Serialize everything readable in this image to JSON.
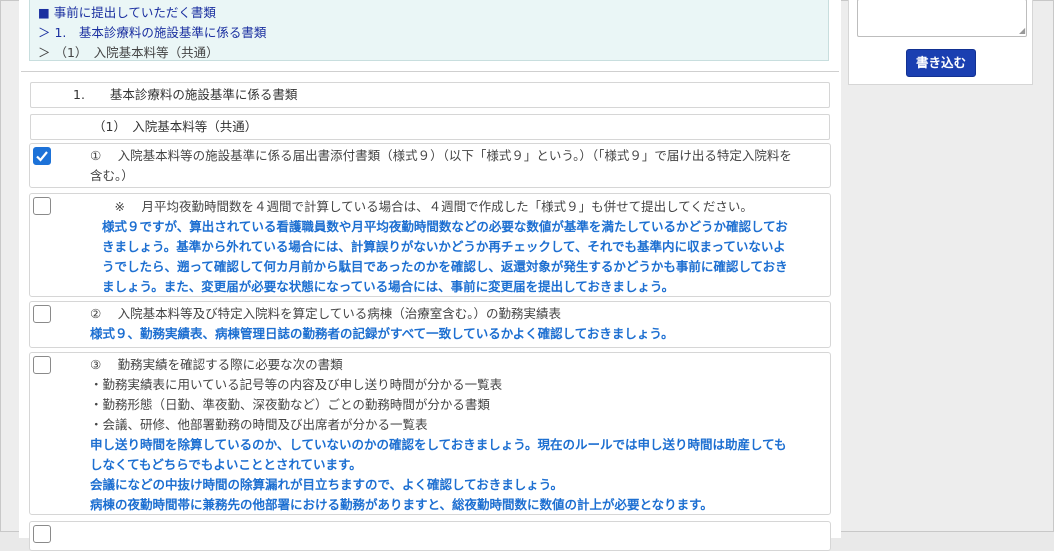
{
  "nav": {
    "title": "■ 事前に提出していただく書類",
    "crumb1": "＞ 1.　基本診療料の施設基準に係る書類",
    "crumb2": "＞ （1）　入院基本料等（共通）"
  },
  "section": {
    "heading": "1.　　基本診療料の施設基準に係る書類",
    "subheading": "（1）　入院基本料等（共通）"
  },
  "items": [
    {
      "checked": true,
      "lines": [
        "①　 入院基本料等の施設基準に係る届出書添付書類（様式９）（以下「様式９」という。）（「様式９」で届け出る特定入院料を",
        "含む。）"
      ],
      "advice": []
    },
    {
      "checked": false,
      "lines": [
        "　※　 月平均夜勤時間数を４週間で計算している場合は、４週間で作成した「様式９」も併せて提出してください。"
      ],
      "advice": [
        "様式９ですが、算出されている看護職員数や月平均夜勤時間数などの必要な数値が基準を満たしているかどうか確認してお",
        "きましょう。基準から外れている場合には、計算誤りがないかどうか再チェックして、それでも基準内に収まっていないよ",
        "うでしたら、遡って確認して何カ月前から駄目であったのかを確認し、返還対象が発生するかどうかも事前に確認しておき",
        "ましょう。また、変更届が必要な状態になっている場合には、事前に変更届を提出しておきましょう。"
      ]
    },
    {
      "checked": false,
      "lines": [
        "②　 入院基本料等及び特定入院料を算定している病棟（治療室含む。）の勤務実績表"
      ],
      "advice": [
        "様式９、勤務実績表、病棟管理日誌の勤務者の記録がすべて一致しているかよく確認しておきましょう。"
      ]
    },
    {
      "checked": false,
      "lines": [
        "③　 勤務実績を確認する際に必要な次の書類",
        "・勤務実績表に用いている記号等の内容及び申し送り時間が分かる一覧表",
        "・勤務形態（日勤、準夜勤、深夜勤など）ごとの勤務時間が分かる書類",
        "・会議、研修、他部署勤務の時間及び出席者が分かる一覧表"
      ],
      "advice": [
        "申し送り時間を除算しているのか、していないのかの確認をしておきましょう。現在のルールでは申し送り時間は助産しても",
        "しなくてもどちらでもよいこととされています。",
        "会議になどの中抜け時間の除算漏れが目立ちますので、よく確認しておきましょう。",
        "病棟の夜勤時間帯に兼務先の他部署における勤務がありますと、総夜勤時間数に数値の計上が必要となります。"
      ]
    }
  ],
  "sidebar": {
    "memo_value": "",
    "write_button": "書き込む"
  },
  "colors": {
    "accent_blue": "#1d6fd1",
    "nav_blue": "#1a2fa0",
    "button_blue": "#1a3fb1",
    "checkbox_checked": "#1d72d8"
  }
}
